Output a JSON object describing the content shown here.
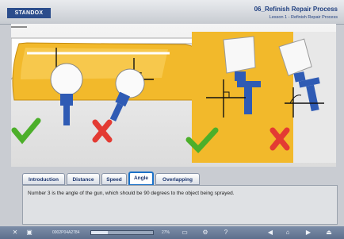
{
  "header": {
    "logo_text": "STANDOX",
    "title": "06_Refinish Repair Process",
    "subtitle": "Lesson 1 - Refinish Repair Process"
  },
  "stage": {
    "left_scene": [
      "correct-check-icon",
      "wrong-x-icon"
    ],
    "right_scene": [
      "correct-check-icon",
      "wrong-x-icon"
    ],
    "colors": {
      "car_yellow": "#f2b92b",
      "check_green": "#4caf2a",
      "x_red": "#e33b33",
      "gun_blue": "#2f5bb4"
    }
  },
  "tabs": [
    {
      "label": "Introduction",
      "active": false
    },
    {
      "label": "Distance",
      "active": false
    },
    {
      "label": "Speed",
      "active": false
    },
    {
      "label": "Angle",
      "active": true
    },
    {
      "label": "Overlapping",
      "active": false
    }
  ],
  "description": "Number 3 is the angle of the gun, which should be 90 degrees to the object being sprayed.",
  "bottom_bar": {
    "code": "0002P04A2784",
    "progress_percent": 27,
    "progress_label": "27%",
    "icons": [
      "close-icon",
      "lock-icon",
      "monitor-icon",
      "tools-icon",
      "help-icon",
      "back-icon",
      "home-icon",
      "next-icon",
      "exit-icon"
    ]
  }
}
